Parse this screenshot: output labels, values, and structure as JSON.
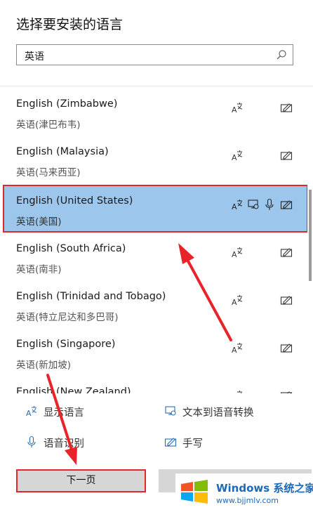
{
  "title": "选择要安装的语言",
  "search": {
    "value": "英语"
  },
  "languages": [
    {
      "name": "English (Zimbabwe)",
      "native": "英语(津巴布韦)",
      "features": [
        "display-language-icon",
        "handwriting-icon"
      ]
    },
    {
      "name": "English (Malaysia)",
      "native": "英语(马来西亚)",
      "features": [
        "display-language-icon",
        "handwriting-icon"
      ]
    },
    {
      "name": "English (United States)",
      "native": "英语(美国)",
      "selected": true,
      "features": [
        "display-language-icon",
        "text-to-speech-icon",
        "speech-recognition-icon",
        "handwriting-icon"
      ]
    },
    {
      "name": "English (South Africa)",
      "native": "英语(南非)",
      "features": [
        "display-language-icon",
        "handwriting-icon"
      ]
    },
    {
      "name": "English (Trinidad and Tobago)",
      "native": "英语(特立尼达和多巴哥)",
      "features": [
        "display-language-icon",
        "handwriting-icon"
      ]
    },
    {
      "name": "English (Singapore)",
      "native": "英语(新加坡)",
      "features": [
        "display-language-icon",
        "handwriting-icon"
      ]
    },
    {
      "name": "English (New Zealand)",
      "native": "",
      "features": [
        "display-language-icon",
        "handwriting-icon"
      ]
    }
  ],
  "legend": {
    "display_language": "显示语言",
    "text_to_speech": "文本到语音转换",
    "speech_recognition": "语音识别",
    "handwriting": "手写"
  },
  "buttons": {
    "next": "下一页",
    "cancel": ""
  },
  "watermark": {
    "brand": "Windows 系统之家",
    "url": "www.bjjmlv.com"
  },
  "colors": {
    "selected_bg": "#9dc6ec",
    "highlight": "#e0282a",
    "accent": "#1466b8"
  }
}
